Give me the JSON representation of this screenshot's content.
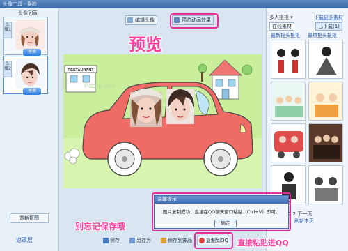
{
  "window": {
    "title": "头像工具 - 换脸"
  },
  "left_panel": {
    "title": "头像列表",
    "slots": [
      {
        "tab": "头像1",
        "replace_label": "替换"
      },
      {
        "tab": "头像2",
        "replace_label": "替换"
      }
    ],
    "reset_label": "重新抠图",
    "bottom_link": "遮罩层"
  },
  "toolbar": {
    "edit_label": "编辑头像",
    "preview_label": "预览动画效果"
  },
  "annotations": {
    "preview": "预览",
    "remember_save": "别忘记保存哦",
    "paste_qq": "直接粘贴进QQ"
  },
  "canvas": {
    "sign_text": "RESTAURANT",
    "watermark": "Pacitu.com"
  },
  "right_panel": {
    "select_label": "多人抠抠 ▾",
    "download_link": "下载更多素材",
    "tab_online": "在线素材",
    "tab_downloaded": "已下载(1)",
    "cat_latest": "最新抠头抠抠",
    "cat_hot": "最热抠头抠抠",
    "pager": "1 2 下一页",
    "refresh": "刷新本页"
  },
  "bottom_bar": {
    "save": "保存",
    "save_as": "另存为",
    "save_to_gift": "保存到饰品",
    "copy_to_qq": "复制到QQ"
  },
  "dialog": {
    "title": "温馨提示",
    "message": "图片复制成功，直接在QQ聊天窗口粘贴（Ctrl+V）即可。",
    "ok_label": "确定"
  },
  "colors": {
    "accent_pink": "#ff3fa0",
    "car_red": "#ef6b66",
    "canvas_bg": "#c9ef9c",
    "link_blue": "#2655a8"
  }
}
